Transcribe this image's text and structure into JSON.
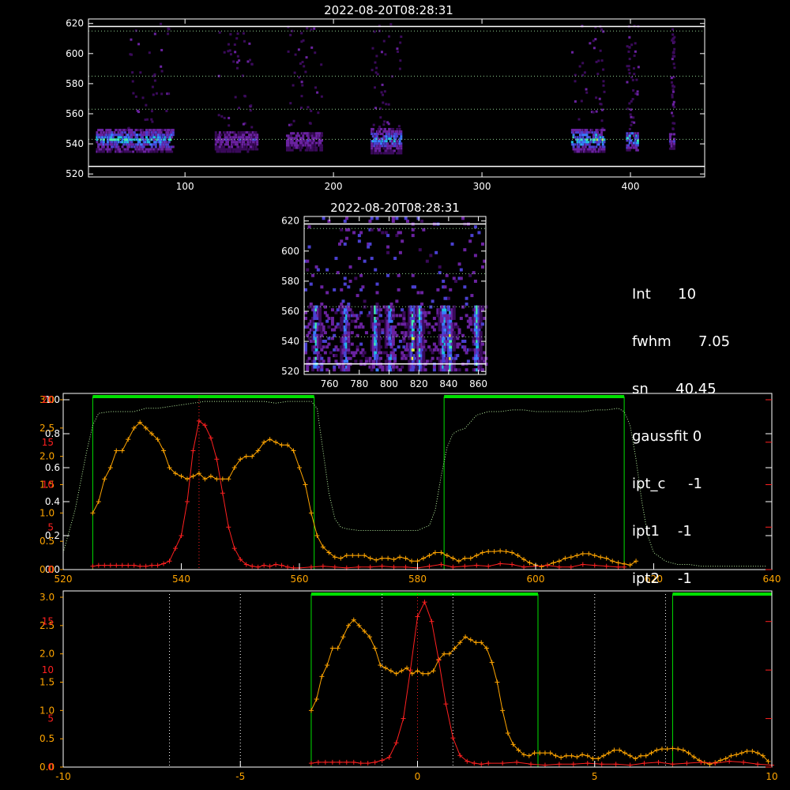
{
  "colors": {
    "background": "#000000",
    "axis": "#ffffff",
    "orange": "#ffa500",
    "red": "#ff2020",
    "green": "#00e000",
    "lightgreen": "#b8f0a0",
    "blue": "#5b7cff",
    "purple": "#7a2aa8"
  },
  "info_panel": {
    "lines": [
      {
        "label": "Int",
        "value": "10"
      },
      {
        "label": "fwhm",
        "value": "7.05"
      },
      {
        "label": "sn",
        "value": "40.45"
      },
      {
        "label": "gaussfit",
        "value": "0"
      },
      {
        "label": "ipt_c",
        "value": "-1"
      },
      {
        "label": "ipt1",
        "value": "-1"
      },
      {
        "label": "ipt2",
        "value": "-1"
      }
    ]
  },
  "chart_data": [
    {
      "id": "overview",
      "type": "heatmap",
      "title": "2022-08-20T08:28:31",
      "xlim": [
        35,
        450
      ],
      "ylim": [
        518,
        623
      ],
      "xticks": [
        100,
        200,
        300,
        400
      ],
      "yticks": [
        520,
        540,
        560,
        580,
        600,
        620
      ],
      "white_lines_y": [
        525,
        618
      ],
      "dotted_lines_y": [
        543,
        563,
        585,
        615
      ],
      "bands": [
        {
          "x": [
            40,
            92
          ],
          "y": [
            534,
            550
          ],
          "level": 0.8
        },
        {
          "x": [
            120,
            148
          ],
          "y": [
            534,
            548
          ],
          "level": 0.45
        },
        {
          "x": [
            168,
            192
          ],
          "y": [
            535,
            547
          ],
          "level": 0.45
        },
        {
          "x": [
            225,
            245
          ],
          "y": [
            533,
            550
          ],
          "level": 0.75
        },
        {
          "x": [
            360,
            382
          ],
          "y": [
            534,
            549
          ],
          "level": 0.9
        },
        {
          "x": [
            397,
            405
          ],
          "y": [
            535,
            547
          ],
          "level": 0.85
        },
        {
          "x": [
            426,
            429
          ],
          "y": [
            536,
            546
          ],
          "level": 0.5
        }
      ],
      "sparse_columns": [
        [
          60,
          90
        ],
        [
          122,
          146
        ],
        [
          168,
          192
        ],
        [
          225,
          245
        ],
        [
          360,
          382
        ],
        [
          397,
          405
        ],
        [
          427,
          429
        ]
      ]
    },
    {
      "id": "zoom",
      "type": "heatmap",
      "title": "2022-08-20T08:28:31",
      "xlim": [
        743,
        865
      ],
      "ylim": [
        518,
        623
      ],
      "xticks": [
        760,
        780,
        800,
        820,
        840,
        860
      ],
      "yticks": [
        520,
        540,
        560,
        580,
        600,
        620
      ],
      "white_lines_y": [
        525,
        618
      ],
      "dotted_lines_y": [
        543,
        563,
        585,
        615
      ],
      "stripes_x": [
        750,
        770,
        790,
        800,
        815,
        820,
        836,
        840,
        858
      ]
    },
    {
      "id": "profile",
      "type": "line",
      "xlim": [
        520,
        640
      ],
      "xticks": [
        520,
        540,
        560,
        580,
        600,
        620,
        640
      ],
      "yticks_left_white": [
        0.0,
        0.2,
        0.4,
        0.6,
        0.8,
        1.0
      ],
      "yticks_left_orange": [
        "0.0",
        "0.5",
        "1.0",
        "1.5",
        "2.0",
        "2.5",
        "3.0"
      ],
      "yticks_left_red": [
        "0",
        "5",
        "10",
        "15",
        "20"
      ],
      "green_boxes": [
        [
          525,
          562.5
        ],
        [
          584.5,
          615
        ]
      ],
      "red_dotted_x": 543,
      "series": [
        {
          "color": "orange",
          "scale_max": 3.0,
          "x": [
            525,
            526,
            527,
            528,
            529,
            530,
            531,
            532,
            533,
            534,
            535,
            536,
            537,
            538,
            539,
            540,
            541,
            542,
            543,
            544,
            545,
            546,
            547,
            548,
            549,
            550,
            551,
            552,
            553,
            554,
            555,
            556,
            557,
            558,
            559,
            560,
            561,
            562,
            563,
            564,
            565,
            566,
            567,
            568,
            569,
            570,
            571,
            572,
            573,
            574,
            575,
            576,
            577,
            578,
            579,
            580,
            581,
            582,
            583,
            584,
            585,
            586,
            587,
            588,
            589,
            590,
            591,
            592,
            593,
            594,
            595,
            596,
            597,
            598,
            599,
            600,
            601,
            602,
            603,
            604,
            605,
            606,
            607,
            608,
            609,
            610,
            611,
            612,
            613,
            614,
            615,
            616,
            617
          ],
          "values": [
            1.0,
            1.2,
            1.6,
            1.8,
            2.1,
            2.1,
            2.3,
            2.5,
            2.6,
            2.5,
            2.4,
            2.3,
            2.1,
            1.8,
            1.7,
            1.65,
            1.6,
            1.65,
            1.7,
            1.6,
            1.65,
            1.6,
            1.6,
            1.6,
            1.8,
            1.95,
            2.0,
            2.0,
            2.1,
            2.25,
            2.3,
            2.25,
            2.2,
            2.2,
            2.1,
            1.8,
            1.5,
            1.0,
            0.6,
            0.4,
            0.3,
            0.22,
            0.2,
            0.25,
            0.25,
            0.25,
            0.25,
            0.2,
            0.17,
            0.2,
            0.2,
            0.18,
            0.22,
            0.2,
            0.15,
            0.15,
            0.2,
            0.25,
            0.3,
            0.3,
            0.25,
            0.2,
            0.15,
            0.2,
            0.2,
            0.25,
            0.3,
            0.32,
            0.32,
            0.33,
            0.32,
            0.3,
            0.25,
            0.18,
            0.12,
            0.08,
            0.05,
            0.08,
            0.12,
            0.15,
            0.2,
            0.22,
            0.25,
            0.28,
            0.28,
            0.25,
            0.22,
            0.2,
            0.15,
            0.12,
            0.1,
            0.08,
            0.15
          ]
        },
        {
          "color": "red",
          "scale_max": 20,
          "x": [
            525,
            526,
            527,
            528,
            529,
            530,
            531,
            532,
            533,
            534,
            535,
            536,
            537,
            538,
            539,
            540,
            541,
            542,
            543,
            544,
            545,
            546,
            547,
            548,
            549,
            550,
            551,
            552,
            553,
            554,
            555,
            556,
            557,
            558,
            559,
            560,
            562,
            564,
            566,
            568,
            570,
            572,
            574,
            576,
            578,
            580,
            582,
            584,
            586,
            588,
            590,
            592,
            594,
            596,
            598,
            600,
            602,
            604,
            606,
            608,
            610,
            612,
            614,
            615
          ],
          "values": [
            0.4,
            0.5,
            0.5,
            0.5,
            0.5,
            0.5,
            0.5,
            0.5,
            0.4,
            0.4,
            0.5,
            0.5,
            0.7,
            1.0,
            2.5,
            4.0,
            8.0,
            14.0,
            17.5,
            17.0,
            15.5,
            13.0,
            9.0,
            5.0,
            2.5,
            1.2,
            0.6,
            0.4,
            0.3,
            0.5,
            0.4,
            0.6,
            0.5,
            0.3,
            0.2,
            0.2,
            0.3,
            0.4,
            0.3,
            0.2,
            0.3,
            0.3,
            0.4,
            0.3,
            0.3,
            0.2,
            0.4,
            0.6,
            0.3,
            0.4,
            0.5,
            0.4,
            0.7,
            0.6,
            0.3,
            0.4,
            0.5,
            0.3,
            0.3,
            0.6,
            0.5,
            0.4,
            0.3,
            0.3
          ]
        },
        {
          "color": "lightgreen",
          "style": "dotted",
          "scale_max": 1.0,
          "x": [
            520,
            522,
            524,
            525,
            526,
            528,
            530,
            532,
            534,
            536,
            538,
            540,
            542,
            544,
            546,
            548,
            550,
            552,
            554,
            556,
            558,
            560,
            562,
            563,
            564,
            565,
            566,
            567,
            568,
            570,
            572,
            574,
            576,
            578,
            580,
            582,
            583,
            584,
            585,
            586,
            587,
            588,
            590,
            592,
            594,
            596,
            598,
            600,
            602,
            604,
            606,
            608,
            610,
            612,
            614,
            615,
            616,
            617,
            618,
            619,
            620,
            622,
            624,
            626,
            628,
            630,
            632,
            634,
            636,
            638,
            639
          ],
          "values": [
            0.1,
            0.35,
            0.7,
            0.85,
            0.92,
            0.93,
            0.93,
            0.93,
            0.95,
            0.95,
            0.96,
            0.97,
            0.98,
            0.99,
            0.99,
            0.99,
            0.99,
            0.99,
            0.99,
            0.98,
            0.99,
            0.99,
            0.99,
            0.95,
            0.7,
            0.45,
            0.3,
            0.25,
            0.24,
            0.23,
            0.23,
            0.23,
            0.23,
            0.23,
            0.23,
            0.26,
            0.35,
            0.55,
            0.72,
            0.8,
            0.82,
            0.83,
            0.91,
            0.93,
            0.93,
            0.94,
            0.94,
            0.93,
            0.93,
            0.93,
            0.93,
            0.93,
            0.94,
            0.94,
            0.95,
            0.93,
            0.85,
            0.65,
            0.4,
            0.2,
            0.1,
            0.05,
            0.03,
            0.03,
            0.02,
            0.02,
            0.02,
            0.02,
            0.02,
            0.02,
            0.02
          ]
        }
      ]
    },
    {
      "id": "velocity",
      "type": "line",
      "xlim": [
        -10,
        10
      ],
      "xticks": [
        -10,
        -5,
        0,
        5,
        10
      ],
      "yticks_left_orange": [
        "0.0",
        "0.5",
        "1.0",
        "1.5",
        "2.0",
        "2.5",
        "3.0"
      ],
      "yticks_left_red": [
        "0",
        "5",
        "10",
        "15"
      ],
      "green_boxes": [
        [
          -3.0,
          3.4
        ],
        [
          7.2,
          10
        ]
      ],
      "dotted_x_white": [
        -7,
        -5,
        -1,
        1,
        5,
        7
      ],
      "red_dotted_x": 0,
      "series": [
        {
          "color": "orange",
          "scale_max": 3.0,
          "x": [
            -3.0,
            -2.85,
            -2.7,
            -2.55,
            -2.4,
            -2.25,
            -2.1,
            -1.95,
            -1.8,
            -1.65,
            -1.5,
            -1.35,
            -1.2,
            -1.05,
            -0.9,
            -0.75,
            -0.6,
            -0.45,
            -0.3,
            -0.15,
            0.0,
            0.15,
            0.3,
            0.45,
            0.6,
            0.75,
            0.9,
            1.05,
            1.2,
            1.35,
            1.5,
            1.65,
            1.8,
            1.95,
            2.1,
            2.25,
            2.4,
            2.55,
            2.7,
            2.85,
            3.0,
            3.15,
            3.3,
            3.45,
            3.6,
            3.75,
            3.9,
            4.05,
            4.2,
            4.35,
            4.5,
            4.65,
            4.8,
            4.95,
            5.1,
            5.25,
            5.4,
            5.55,
            5.7,
            5.85,
            6.0,
            6.15,
            6.3,
            6.45,
            6.6,
            6.75,
            6.9,
            7.05,
            7.2,
            7.35,
            7.5,
            7.65,
            7.8,
            7.95,
            8.1,
            8.25,
            8.4,
            8.55,
            8.7,
            8.85,
            9.0,
            9.15,
            9.3,
            9.45,
            9.6,
            9.75,
            9.9
          ],
          "values": [
            1.0,
            1.2,
            1.6,
            1.8,
            2.1,
            2.1,
            2.3,
            2.5,
            2.6,
            2.5,
            2.4,
            2.3,
            2.1,
            1.8,
            1.75,
            1.7,
            1.65,
            1.7,
            1.75,
            1.65,
            1.7,
            1.65,
            1.65,
            1.7,
            1.9,
            2.0,
            2.0,
            2.1,
            2.2,
            2.3,
            2.25,
            2.2,
            2.2,
            2.1,
            1.85,
            1.5,
            1.0,
            0.6,
            0.4,
            0.3,
            0.22,
            0.2,
            0.25,
            0.25,
            0.25,
            0.25,
            0.2,
            0.17,
            0.2,
            0.2,
            0.18,
            0.22,
            0.2,
            0.15,
            0.15,
            0.2,
            0.25,
            0.3,
            0.3,
            0.25,
            0.2,
            0.15,
            0.2,
            0.2,
            0.25,
            0.3,
            0.32,
            0.32,
            0.33,
            0.32,
            0.3,
            0.25,
            0.18,
            0.12,
            0.08,
            0.05,
            0.08,
            0.12,
            0.15,
            0.2,
            0.22,
            0.25,
            0.28,
            0.28,
            0.25,
            0.2,
            0.1
          ]
        },
        {
          "color": "red",
          "scale_max": 17.5,
          "x": [
            -3.0,
            -2.8,
            -2.6,
            -2.4,
            -2.2,
            -2.0,
            -1.8,
            -1.6,
            -1.4,
            -1.2,
            -1.0,
            -0.8,
            -0.6,
            -0.4,
            -0.2,
            0.0,
            0.2,
            0.4,
            0.6,
            0.8,
            1.0,
            1.2,
            1.4,
            1.6,
            1.8,
            2.0,
            2.4,
            2.8,
            3.2,
            3.6,
            4.0,
            4.4,
            4.8,
            5.2,
            5.6,
            6.0,
            6.4,
            6.8,
            7.2,
            7.6,
            8.0,
            8.4,
            8.8,
            9.2,
            9.6,
            10.0
          ],
          "values": [
            0.4,
            0.5,
            0.5,
            0.5,
            0.5,
            0.5,
            0.5,
            0.4,
            0.4,
            0.5,
            0.7,
            1.0,
            2.5,
            5.0,
            10.0,
            15.5,
            17.0,
            15.0,
            11.0,
            6.5,
            3.0,
            1.2,
            0.6,
            0.4,
            0.3,
            0.4,
            0.4,
            0.5,
            0.3,
            0.2,
            0.3,
            0.3,
            0.4,
            0.3,
            0.3,
            0.2,
            0.4,
            0.5,
            0.3,
            0.4,
            0.5,
            0.4,
            0.6,
            0.5,
            0.3,
            0.2
          ]
        }
      ]
    }
  ]
}
